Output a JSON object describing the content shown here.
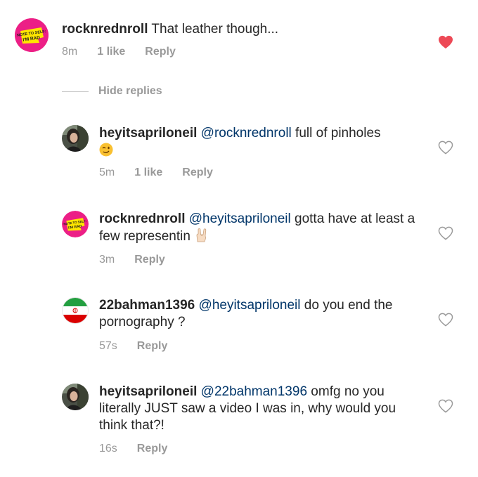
{
  "comments": [
    {
      "username": "rocknrednroll",
      "mention": "",
      "text": " That leather though...",
      "time": "8m",
      "likes": "1 like",
      "reply": "Reply",
      "liked": true,
      "avatar": "note-to-self-logo",
      "avatar_text": [
        "NOTE TO SELF:",
        "I'M RAD"
      ]
    },
    {
      "username": "heyitsapriloneil",
      "mention": "@rocknrednroll",
      "text": " full of pinholes",
      "emoji": "winking-face",
      "time": "5m",
      "likes": "1 like",
      "reply": "Reply",
      "liked": false,
      "avatar": "photo-woman"
    },
    {
      "username": "rocknrednroll",
      "mention": "@heyitsapriloneil",
      "text": " gotta have at least a few representin",
      "emoji": "sign-of-horns",
      "time": "3m",
      "likes": "",
      "reply": "Reply",
      "liked": false,
      "avatar": "note-to-self-logo",
      "avatar_text": [
        "NOTE TO SELF:",
        "I'M RAD"
      ]
    },
    {
      "username": "22bahman1396",
      "mention": "@heyitsapriloneil",
      "text": " do you end the pornography ?",
      "time": "57s",
      "likes": "",
      "reply": "Reply",
      "liked": false,
      "avatar": "iran-flag"
    },
    {
      "username": "heyitsapriloneil",
      "mention": "@22bahman1396",
      "text": " omfg no you literally JUST saw a video I was in, why would you think that?!",
      "time": "16s",
      "likes": "",
      "reply": "Reply",
      "liked": false,
      "avatar": "photo-woman"
    }
  ],
  "hide_replies_label": "Hide replies",
  "colors": {
    "heart_liked": "#ed4956",
    "heart_outline": "#999999",
    "mention": "#003569",
    "meta": "#999999",
    "logo_pink": "#ec1f86",
    "logo_yellow": "#ffe600"
  }
}
